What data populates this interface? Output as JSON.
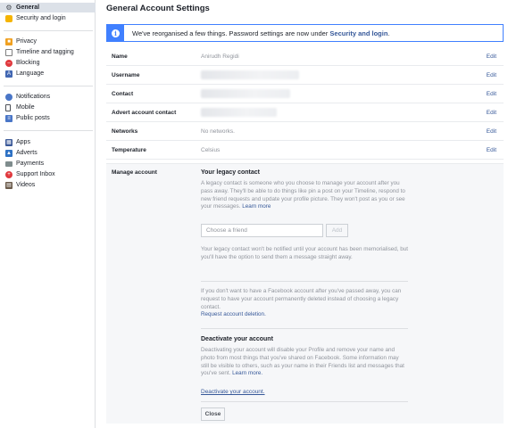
{
  "sidebar": {
    "items": [
      {
        "label": "General",
        "icon": "gear-icon",
        "active": true
      },
      {
        "label": "Security and login",
        "icon": "shield-icon"
      },
      {
        "label": "Privacy",
        "icon": "lock-icon"
      },
      {
        "label": "Timeline and tagging",
        "icon": "timeline-icon"
      },
      {
        "label": "Blocking",
        "icon": "blocking-icon"
      },
      {
        "label": "Language",
        "icon": "language-icon"
      },
      {
        "label": "Notifications",
        "icon": "globe-icon"
      },
      {
        "label": "Mobile",
        "icon": "mobile-icon"
      },
      {
        "label": "Public posts",
        "icon": "rss-icon"
      },
      {
        "label": "Apps",
        "icon": "apps-icon"
      },
      {
        "label": "Adverts",
        "icon": "adverts-icon"
      },
      {
        "label": "Payments",
        "icon": "card-icon"
      },
      {
        "label": "Support Inbox",
        "icon": "lifebuoy-icon"
      },
      {
        "label": "Videos",
        "icon": "film-icon"
      }
    ]
  },
  "header": {
    "title": "General Account Settings"
  },
  "notice": {
    "text": "We've reorganised a few things. Password settings are now under ",
    "link": "Security and login",
    "suffix": "."
  },
  "settings": {
    "edit_label": "Edit",
    "rows": [
      {
        "label": "Name",
        "value": "Anirudh Regidi"
      },
      {
        "label": "Username",
        "value": ""
      },
      {
        "label": "Contact",
        "value": ""
      },
      {
        "label": "Advert account contact",
        "value": ""
      },
      {
        "label": "Networks",
        "value": "No networks."
      },
      {
        "label": "Temperature",
        "value": "Celsius"
      }
    ]
  },
  "manage": {
    "label": "Manage account",
    "legacy_heading": "Your legacy contact",
    "legacy_text": "A legacy contact is someone who you choose to manage your account after you pass away. They'll be able to do things like pin a post on your Timeline, respond to new friend requests and update your profile picture. They won't post as you or see your messages.",
    "learn_more": "Learn more",
    "friend_placeholder": "Choose a friend",
    "add_label": "Add",
    "notify_text": "Your legacy contact won't be notified until your account has been memorialised, but you'll have the option to send them a message straight away.",
    "delete_text": "If you don't want to have a Facebook account after you've passed away, you can request to have your account permanently deleted instead of choosing a legacy contact.",
    "delete_link": "Request account deletion.",
    "deactivate_heading": "Deactivate your account",
    "deactivate_text": "Deactivating your account will disable your Profile and remove your name and photo from most things that you've shared on Facebook. Some information may still be visible to others, such as your name in their Friends list and messages that you've sent.",
    "deactivate_learn_more": "Learn more.",
    "deactivate_link": "Deactivate your account.",
    "close_label": "Close"
  },
  "colors": {
    "accent": "#4080ff",
    "link": "#365899",
    "muted": "#90949c"
  }
}
